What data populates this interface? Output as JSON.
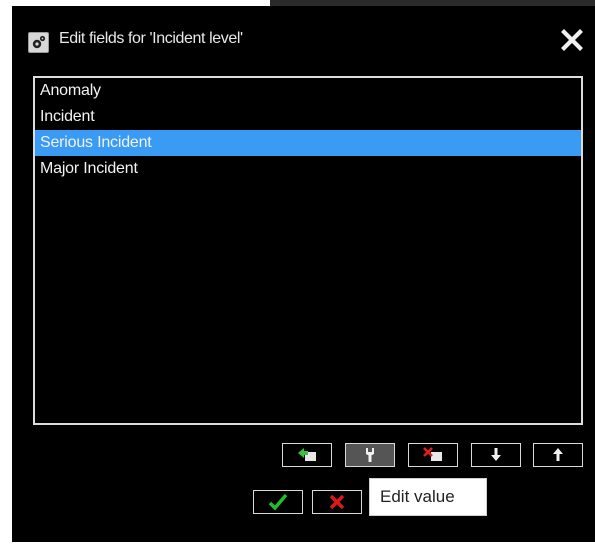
{
  "dialog": {
    "title": "Edit fields for 'Incident level'",
    "icon": "gear-icon",
    "close_icon": "close-icon"
  },
  "list": {
    "items": [
      {
        "label": "Anomaly",
        "selected": false
      },
      {
        "label": "Incident",
        "selected": false
      },
      {
        "label": "Serious Incident",
        "selected": true
      },
      {
        "label": "Major Incident",
        "selected": false
      }
    ],
    "selection_color": "#3a9bf5"
  },
  "toolbar": {
    "buttons": [
      {
        "name": "add-value",
        "icon": "add-value-icon"
      },
      {
        "name": "edit-value",
        "icon": "edit-value-icon"
      },
      {
        "name": "delete-value",
        "icon": "delete-value-icon"
      },
      {
        "name": "move-down",
        "icon": "arrow-down-icon"
      },
      {
        "name": "move-up",
        "icon": "arrow-up-icon"
      }
    ]
  },
  "footer": {
    "ok_icon": "checkmark-icon",
    "cancel_icon": "cross-icon",
    "ok_color": "#22c02a",
    "cancel_color": "#e01818"
  },
  "tooltip": {
    "text": "Edit value"
  }
}
